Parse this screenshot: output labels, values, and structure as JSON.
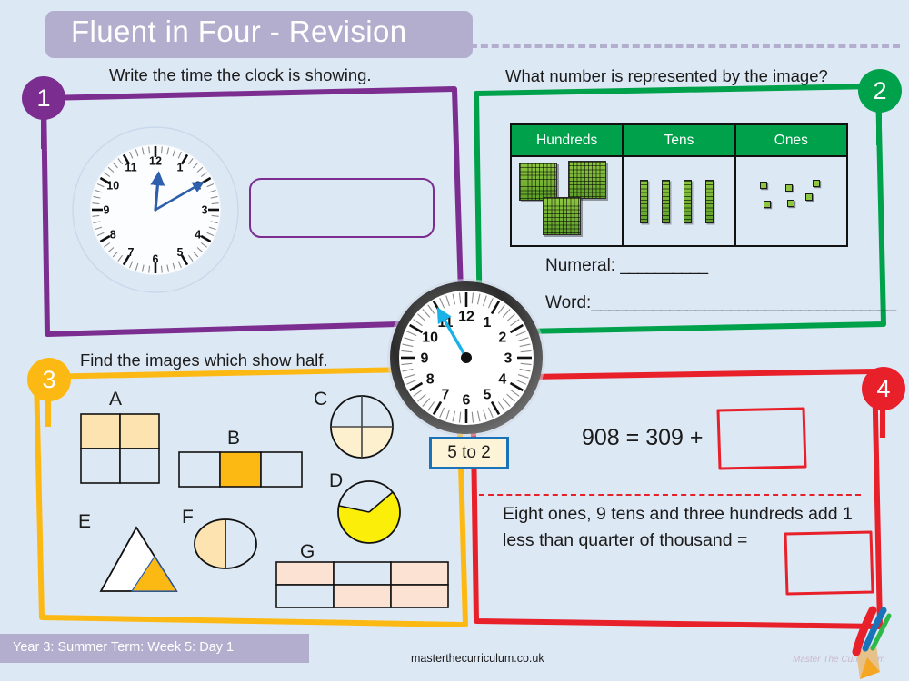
{
  "title": {
    "text": "Fluent in Four - Revision"
  },
  "questions": [
    {
      "number": "1",
      "color": "#7b2d90",
      "prompt": "Write the time the clock is showing.",
      "clock": {
        "hour": 12,
        "minute": 10,
        "hand_color": "#2d5fad"
      },
      "answer_value": ""
    },
    {
      "number": "2",
      "color": "#00a14b",
      "prompt": "What number is represented by the image?",
      "table": {
        "headers": [
          "Hundreds",
          "Tens",
          "Ones"
        ],
        "counts": {
          "hundreds": 3,
          "tens": 4,
          "ones": 6
        }
      },
      "numeral_label": "Numeral:",
      "numeral_blank": "__________",
      "word_label": "Word:",
      "word_blank": "___________________________________"
    },
    {
      "number": "3",
      "color": "#fdb913",
      "prompt": "Find the images which show half.",
      "shapes": [
        {
          "id": "A",
          "kind": "rect-grid",
          "rows": 2,
          "cols": 2,
          "shaded": [
            0,
            1
          ],
          "fill": "#fce3b0"
        },
        {
          "id": "B",
          "kind": "rect-grid",
          "rows": 1,
          "cols": 3,
          "shaded": [
            1
          ],
          "fill": "#fcb813"
        },
        {
          "id": "C",
          "kind": "circle-quarters",
          "shaded": 2,
          "fill": "#fcf0cf"
        },
        {
          "id": "D",
          "kind": "circle-sector",
          "fraction": 0.62,
          "fill": "#fbee08"
        },
        {
          "id": "E",
          "kind": "triangle-part",
          "fill": "#fcb813"
        },
        {
          "id": "F",
          "kind": "ellipse-half",
          "fill": "#fce3b0"
        },
        {
          "id": "G",
          "kind": "rect-grid",
          "rows": 2,
          "cols": 3,
          "shaded": [
            0,
            2,
            4,
            5
          ],
          "fill": "#fbe2d2"
        }
      ]
    },
    {
      "number": "4",
      "color": "#e8202a",
      "equation": "908 = 309 +",
      "word_problem": "Eight ones, 9 tens and three hundreds add 1 less than quarter of thousand =",
      "answer_a": "",
      "answer_b": ""
    }
  ],
  "center_clock": {
    "hour": 2,
    "minute": 55,
    "hand_color": "#19b2e8",
    "caption": "5 to 2"
  },
  "footer": {
    "term": "Year 3: Summer Term: Week 5: Day 1",
    "website": "masterthecurriculum.co.uk",
    "logo_text": "Master The Curriculum"
  },
  "colors": {
    "background": "#dde8f5",
    "title_bar": "#b3aece",
    "q1": "#7b2d90",
    "q2": "#00a14b",
    "q3": "#fdb913",
    "q4": "#e8202a"
  }
}
